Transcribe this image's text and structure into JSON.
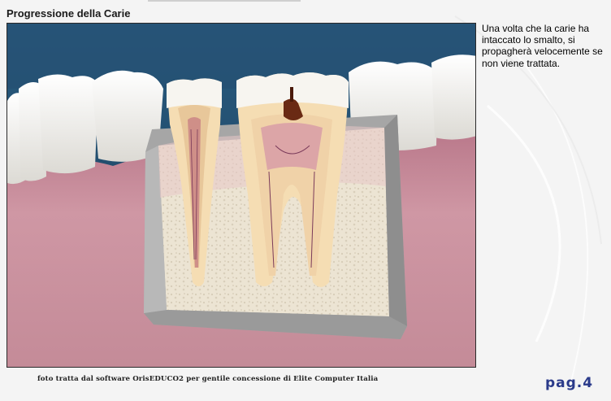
{
  "title": "Progressione della Carie",
  "description": "Una volta che la carie ha intaccato lo smalto, si propagherà velocemente se non viene trattata.",
  "credit": "foto tratta dal software OrisEDUCO2 per gentile concessione di Elite Computer Italia",
  "page_number": "pag.4",
  "colors": {
    "background": "#f4f4f4",
    "page_number": "#2a3a8a",
    "sky": "#1f4a6a",
    "gum": "#c98f9c",
    "bone": "#e8e0cf",
    "dentin": "#eed3a6",
    "enamel": "#f5f3ee",
    "decay": "#6a2a14"
  }
}
